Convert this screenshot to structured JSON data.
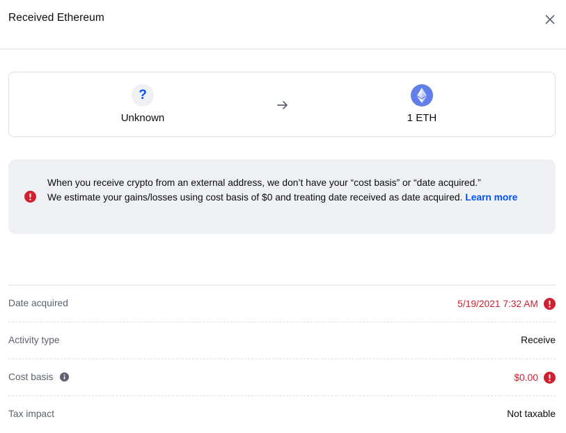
{
  "header": {
    "title": "Received Ethereum"
  },
  "transfer": {
    "from_label": "Unknown",
    "from_icon_glyph": "?",
    "to_label": "1 ETH"
  },
  "notice": {
    "line1": "When you receive crypto from an external address, we don’t have your “cost basis” or “date acquired.”",
    "line2": "We estimate your gains/losses using cost basis of $0 and treating date received as date acquired. ",
    "link": "Learn more"
  },
  "details": {
    "date_acquired_label": "Date acquired",
    "date_acquired_value": "5/19/2021 7:32 AM",
    "activity_type_label": "Activity type",
    "activity_type_value": "Receive",
    "cost_basis_label": "Cost basis",
    "cost_basis_value": "$0.00",
    "tax_impact_label": "Tax impact",
    "tax_impact_value": "Not taxable"
  },
  "colors": {
    "accent": "#0052ff",
    "warning": "#cf202f",
    "eth": "#627eea",
    "muted": "#5b616e",
    "panel": "#eef0f3"
  }
}
